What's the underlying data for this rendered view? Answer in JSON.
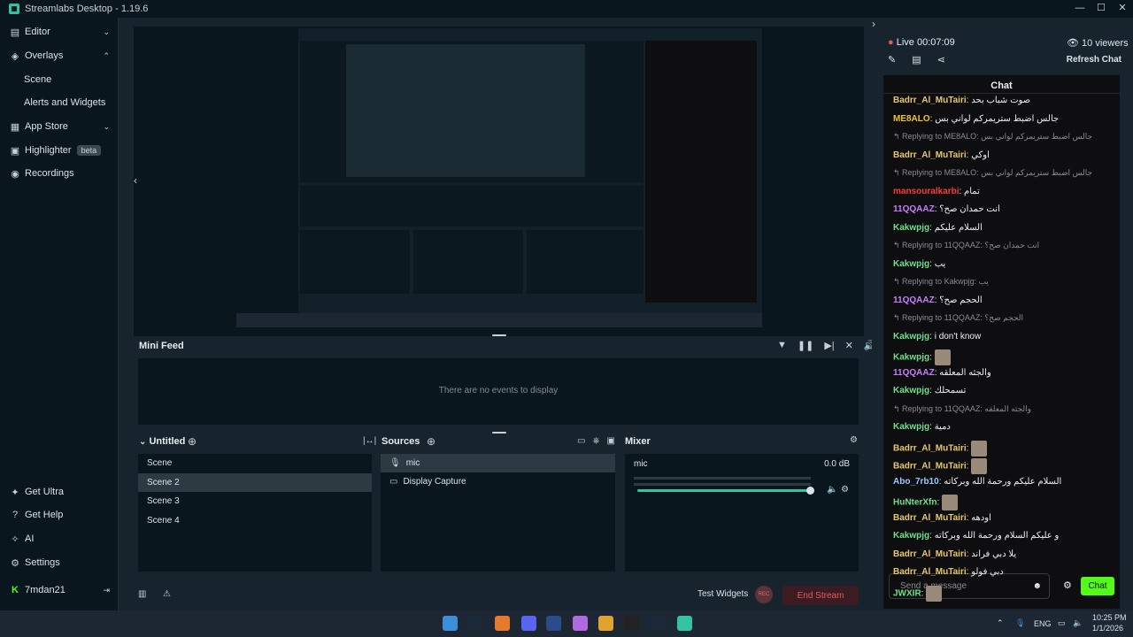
{
  "app": {
    "title": "Streamlabs Desktop - 1.19.6",
    "min": "—",
    "max": "☐",
    "close": "✕"
  },
  "sidebar": {
    "editor": "Editor",
    "overlays": "Overlays",
    "scene": "Scene",
    "alerts": "Alerts and Widgets",
    "app_store": "App Store",
    "highlighter": "Highlighter",
    "beta": "beta",
    "recordings": "Recordings",
    "get_ultra": "Get Ultra",
    "get_help": "Get Help",
    "ai": "AI",
    "settings": "Settings",
    "user": "7mdan21"
  },
  "mini_feed": {
    "title": "Mini Feed",
    "empty": "There are no events to display"
  },
  "scenes": {
    "title": "Untitled",
    "items": [
      "Scene",
      "Scene 2",
      "Scene 3",
      "Scene 4"
    ],
    "selected": 1
  },
  "sources": {
    "title": "Sources",
    "items": [
      "mic",
      "Display Capture"
    ]
  },
  "mixer": {
    "title": "Mixer",
    "channel": "mic",
    "level": "0.0 dB",
    "volume": 0.9
  },
  "bottom": {
    "test_widgets": "Test Widgets",
    "rec": "REC",
    "end_stream": "End Stream"
  },
  "chat_panel": {
    "live": "Live",
    "time": "00:07:09",
    "viewers": "10 viewers",
    "refresh": "Refresh Chat",
    "title": "Chat",
    "placeholder": "Send a message",
    "send": "Chat",
    "messages": [
      {
        "type": "msg",
        "user": "Badrr_Al_MuTairi",
        "color": "#e8c86a",
        "text": "صوت شباب بحد"
      },
      {
        "type": "msg",
        "user": "ME8ALO",
        "color": "#f1c232",
        "text": "جالس اضبط ستريمركم لواني بس"
      },
      {
        "type": "reply",
        "text": "Replying to ME8ALO: جالس اضبط ستريمركم لواني بس"
      },
      {
        "type": "msg",
        "user": "Badrr_Al_MuTairi",
        "color": "#e8c86a",
        "text": "اوكي"
      },
      {
        "type": "reply",
        "text": "Replying to ME8ALO: جالس اضبط ستريمركم لواني بس"
      },
      {
        "type": "msg",
        "user": "mansouralkarbi",
        "color": "#ff3b3b",
        "text": "تمام"
      },
      {
        "type": "msg",
        "user": "11QQAAZ",
        "color": "#c77dff",
        "text": "انت حمدان صح؟"
      },
      {
        "type": "msg",
        "user": "Kakwpjg",
        "color": "#6fe08a",
        "text": "السلام عليكم"
      },
      {
        "type": "reply",
        "text": "Replying to 11QQAAZ: انت حمدان صح؟"
      },
      {
        "type": "msg",
        "user": "Kakwpjg",
        "color": "#6fe08a",
        "text": "يب"
      },
      {
        "type": "reply",
        "text": "Replying to Kakwpjg: يب"
      },
      {
        "type": "msg",
        "user": "11QQAAZ",
        "color": "#c77dff",
        "text": "الحجم صح؟"
      },
      {
        "type": "reply",
        "text": "Replying to 11QQAAZ: الحجم صح؟"
      },
      {
        "type": "msg",
        "user": "Kakwpjg",
        "color": "#6fe08a",
        "text": "i don't know"
      },
      {
        "type": "emote",
        "user": "Kakwpjg",
        "color": "#6fe08a"
      },
      {
        "type": "msg",
        "user": "11QQAAZ",
        "color": "#c77dff",
        "text": "والجثه المعلقه"
      },
      {
        "type": "msg",
        "user": "Kakwpjg",
        "color": "#6fe08a",
        "text": "تسمحلك"
      },
      {
        "type": "reply",
        "text": "Replying to 11QQAAZ: والجثه المعلقه"
      },
      {
        "type": "msg",
        "user": "Kakwpjg",
        "color": "#6fe08a",
        "text": "دمية"
      },
      {
        "type": "emote",
        "user": "Badrr_Al_MuTairi",
        "color": "#e8c86a"
      },
      {
        "type": "emote",
        "user": "Badrr_Al_MuTairi",
        "color": "#e8c86a"
      },
      {
        "type": "msg",
        "user": "Abo_7rb10",
        "color": "#9bc8ff",
        "text": "السلام عليكم ورحمة الله وبركاته"
      },
      {
        "type": "emote",
        "user": "HuNterXfn",
        "color": "#6fe08a"
      },
      {
        "type": "msg",
        "user": "Badrr_Al_MuTairi",
        "color": "#e8c86a",
        "text": "اودهه"
      },
      {
        "type": "msg",
        "user": "Kakwpjg",
        "color": "#6fe08a",
        "text": "و عليكم السلام ورحمة الله وبركاته"
      },
      {
        "type": "msg",
        "user": "Badrr_Al_MuTairi",
        "color": "#e8c86a",
        "text": "يلا دبي فراند"
      },
      {
        "type": "msg",
        "user": "Badrr_Al_MuTairi",
        "color": "#e8c86a",
        "text": "دبي فولو"
      },
      {
        "type": "emote",
        "user": "JWXIR",
        "color": "#6fe08a"
      }
    ]
  },
  "taskbar": {
    "lang": "ENG",
    "time": "10:25 PM",
    "date": "1/1/2026"
  }
}
